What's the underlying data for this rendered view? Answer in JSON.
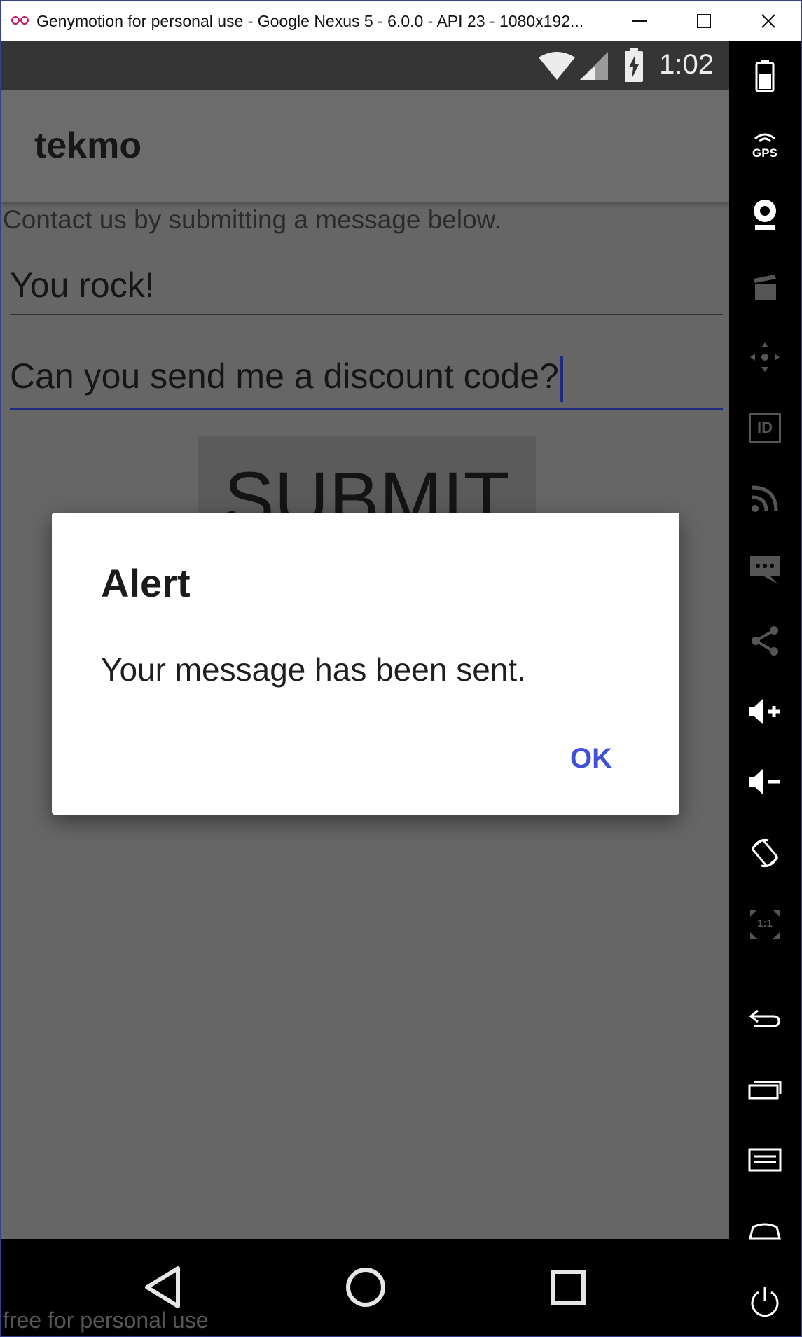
{
  "window": {
    "title": "Genymotion for personal use - Google Nexus 5 - 6.0.0 - API 23 - 1080x192...",
    "logo_icon": "genymotion-logo-icon",
    "controls": [
      "minimize-icon",
      "maximize-icon",
      "close-icon"
    ]
  },
  "status_bar": {
    "time": "1:02",
    "icons": [
      "wifi-icon",
      "cellular-signal-icon",
      "battery-charging-icon"
    ]
  },
  "app_bar": {
    "title": "tekmo"
  },
  "form": {
    "intro": "Contact us by submitting a message below.",
    "subject_value": "You rock!",
    "message_value": "Can you send me a discount code?",
    "submit_label": "SUBMIT"
  },
  "dialog": {
    "title": "Alert",
    "message": "Your message has been sent.",
    "ok_label": "OK"
  },
  "nav_bar": {
    "buttons": [
      "back-icon",
      "home-icon",
      "recents-icon"
    ]
  },
  "watermark": "free for personal use",
  "toolbar": {
    "items": [
      "battery-icon",
      "gps-icon",
      "webcam-icon",
      "media-icon",
      "move-icon",
      "id-icon",
      "rss-icon",
      "sms-icon",
      "share-icon",
      "volume-up-icon",
      "volume-down-icon",
      "rotate-icon",
      "pixel-perfect-icon",
      "back-icon",
      "recent-apps-icon",
      "menu-icon",
      "home-icon",
      "power-icon"
    ],
    "gps_label": "GPS",
    "id_label": "ID",
    "scale_label": "1:1"
  },
  "colors": {
    "accent": "#3f51d8",
    "text_field_focus": "#1f2a80",
    "scrim_background": "#666666",
    "window_frame": "#3a3f8a"
  }
}
